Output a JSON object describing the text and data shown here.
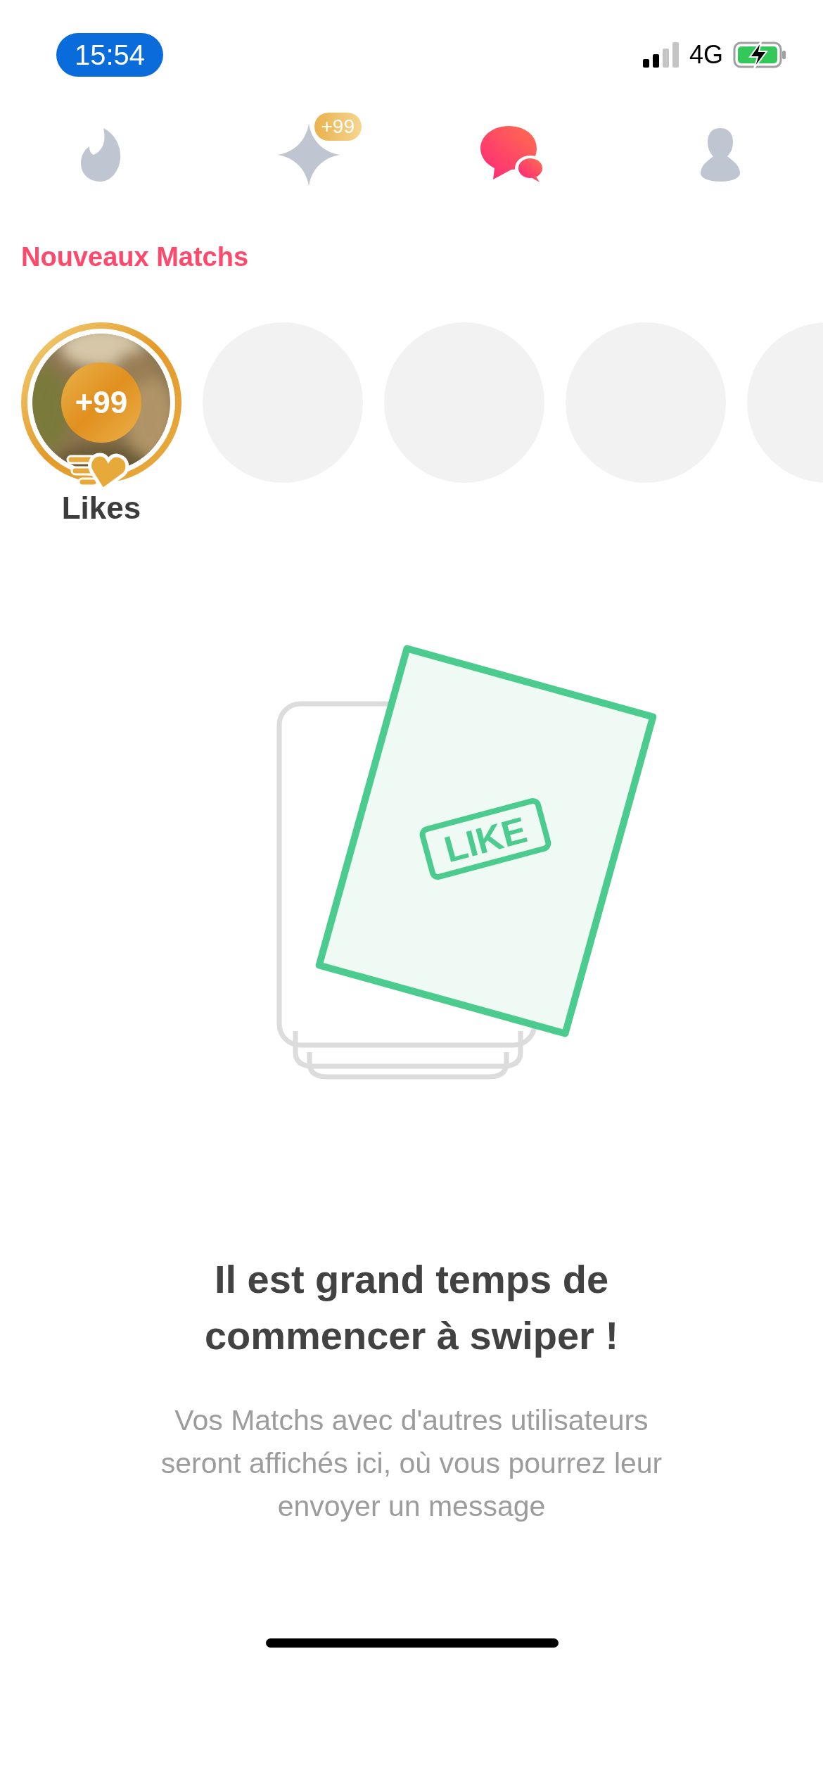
{
  "status_bar": {
    "time": "15:54",
    "network": "4G"
  },
  "nav_tabs": [
    {
      "kind": "flame",
      "selected": false
    },
    {
      "kind": "sparkle",
      "selected": false,
      "badge": "+99"
    },
    {
      "kind": "chat",
      "selected": true
    },
    {
      "kind": "profile",
      "selected": false
    }
  ],
  "new_matches": {
    "title": "Nouveaux Matchs",
    "items": [
      {
        "kind": "likes",
        "count": "+99",
        "label": "Likes"
      },
      {
        "kind": "placeholder"
      },
      {
        "kind": "placeholder"
      },
      {
        "kind": "placeholder"
      },
      {
        "kind": "placeholder"
      }
    ]
  },
  "empty_state": {
    "stamp": "LIKE",
    "heading": "Il est grand temps de commencer à swiper !",
    "body": "Vos Matchs avec d'autres utilisateurs seront affichés ici, où vous pourrez leur envoyer un message"
  }
}
